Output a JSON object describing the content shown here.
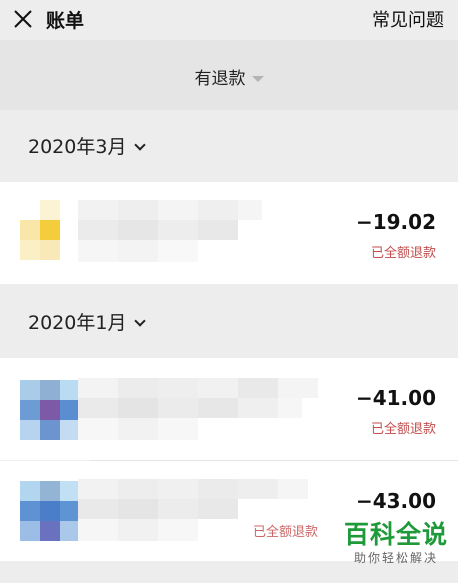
{
  "header": {
    "title": "账单",
    "help_label": "常见问题"
  },
  "filter": {
    "label": "有退款"
  },
  "groups": [
    {
      "month": "2020年3月",
      "items": [
        {
          "amount": "−19.02",
          "status": "已全额退款"
        }
      ]
    },
    {
      "month": "2020年1月",
      "items": [
        {
          "amount": "−41.00",
          "status": "已全额退款"
        },
        {
          "amount": "−43.00",
          "status": "已全额退款"
        }
      ]
    }
  ],
  "watermark": {
    "title": "百科全说",
    "subtitle": "助你轻松解决"
  },
  "colors": {
    "background": "#ededed",
    "refund_text": "#c44d4d",
    "watermark_green": "#1f9a3a"
  }
}
